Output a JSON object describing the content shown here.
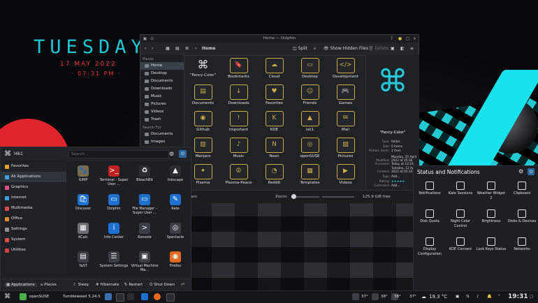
{
  "desktop": {
    "day": "TUESDAY",
    "date": "17 MAY 2022",
    "time": "· 07:31 PM ·",
    "accent": "#1fc7d6",
    "date_color": "#e23a3a"
  },
  "dolphin": {
    "title": "Home — Dolphin",
    "toolbar": {
      "location": "Home",
      "split": "Split",
      "show_hidden": "Show Hidden Files",
      "delete": "Delete"
    },
    "places_header": "Places",
    "places": [
      "Home",
      "Desktop",
      "Documents",
      "Downloads",
      "Music",
      "Pictures",
      "Videos",
      "Trash"
    ],
    "search_header": "Search For",
    "search_items": [
      "Documents",
      "Images"
    ],
    "files": [
      {
        "name": "\"Fancy-Color\"",
        "icon": "plasma-command-icon"
      },
      {
        "name": "Bookmarks",
        "icon": "bookmark-icon"
      },
      {
        "name": "Cloud",
        "icon": "cloud-icon"
      },
      {
        "name": "Desktop",
        "icon": "desktop-icon"
      },
      {
        "name": "Development",
        "icon": "code-icon"
      },
      {
        "name": "Documents",
        "icon": "document-icon"
      },
      {
        "name": "Downloads",
        "icon": "download-icon"
      },
      {
        "name": "Favorites",
        "icon": "heart-icon"
      },
      {
        "name": "Friends",
        "icon": "people-icon"
      },
      {
        "name": "Games",
        "icon": "gamepad-icon"
      },
      {
        "name": "Github",
        "icon": "github-icon"
      },
      {
        "name": "Important",
        "icon": "warning-icon"
      },
      {
        "name": "KDE",
        "icon": "kde-icon"
      },
      {
        "name": "lsk1",
        "icon": "android-icon"
      },
      {
        "name": "Mail",
        "icon": "mail-icon"
      },
      {
        "name": "Manjaro",
        "icon": "manjaro-icon"
      },
      {
        "name": "Music",
        "icon": "music-icon"
      },
      {
        "name": "Neon",
        "icon": "neon-icon"
      },
      {
        "name": "openSUSE",
        "icon": "opensuse-icon"
      },
      {
        "name": "Pictures",
        "icon": "picture-icon"
      },
      {
        "name": "Plasma",
        "icon": "plasma-icon"
      },
      {
        "name": "Plasma-Peace",
        "icon": "peace-icon"
      },
      {
        "name": "Reddit",
        "icon": "reddit-icon"
      },
      {
        "name": "Templates",
        "icon": "template-icon"
      },
      {
        "name": "Videos",
        "icon": "video-icon"
      }
    ],
    "info": {
      "name": "\"Fancy-Color\"",
      "rows": [
        {
          "k": "Type:",
          "v": "folder"
        },
        {
          "k": "Size:",
          "v": "0 items"
        },
        {
          "k": "Hidden items:",
          "v": "1 item"
        },
        {
          "k": "Modified:",
          "v": "Monday, 25 April 2022 at 05:30"
        },
        {
          "k": "Accessed:",
          "v": "Today at 12:16"
        },
        {
          "k": "Created:",
          "v": "Tuesday, 12 April 2022 at 05:30"
        },
        {
          "k": "Tags:",
          "v": "Add..."
        },
        {
          "k": "Rating:",
          "v": "★★★★★"
        },
        {
          "k": "Comment:",
          "v": "Add..."
        }
      ]
    },
    "status": {
      "folders": "olders",
      "zoom_label": "Zoom:",
      "free": "125.9 GiB free"
    }
  },
  "launcher": {
    "user": "l4k1",
    "search_placeholder": "Search...",
    "categories": [
      {
        "label": "Favorites",
        "color": "#e0a030"
      },
      {
        "label": "All Applications",
        "color": "#3da0e0"
      },
      {
        "label": "Graphics",
        "color": "#e04a8a"
      },
      {
        "label": "Internet",
        "color": "#3da0e0"
      },
      {
        "label": "Multimedia",
        "color": "#e04a4a"
      },
      {
        "label": "Office",
        "color": "#e08a30"
      },
      {
        "label": "Settings",
        "color": "#8a9096"
      },
      {
        "label": "System",
        "color": "#e04a4a"
      },
      {
        "label": "Utilities",
        "color": "#d04040"
      }
    ],
    "apps": [
      {
        "label": "GIMP",
        "icon": "gimp-icon",
        "color": "#7a6a50",
        "glyph": "🐾"
      },
      {
        "label": "Terminal - Super User ...",
        "icon": "terminal-icon",
        "color": "#c02020",
        "glyph": ">_"
      },
      {
        "label": "BleachBit",
        "icon": "bleachbit-icon",
        "color": "#2a2e33",
        "glyph": "♻"
      },
      {
        "label": "Inkscape",
        "icon": "inkscape-icon",
        "color": "#2a2e33",
        "glyph": "▲"
      },
      {
        "label": "Discover",
        "icon": "discover-icon",
        "color": "#1d6fd0",
        "glyph": "🛍"
      },
      {
        "label": "Dolphin",
        "icon": "dolphin-icon",
        "color": "#1d6fd0",
        "glyph": "▭"
      },
      {
        "label": "File Manager - Super User ...",
        "icon": "file-manager-icon",
        "color": "#1d6fd0",
        "glyph": "▭"
      },
      {
        "label": "Kate",
        "icon": "kate-icon",
        "color": "#1d6fd0",
        "glyph": "✎"
      },
      {
        "label": "KCalc",
        "icon": "kcalc-icon",
        "color": "#6a6f76",
        "glyph": "▦"
      },
      {
        "label": "Info Center",
        "icon": "info-icon",
        "color": "#1d6fd0",
        "glyph": "i"
      },
      {
        "label": "Konsole",
        "icon": "konsole-icon",
        "color": "#3a3f45",
        "glyph": ">"
      },
      {
        "label": "Spectacle",
        "icon": "spectacle-icon",
        "color": "#3a3f45",
        "glyph": "◎"
      },
      {
        "label": "YaST",
        "icon": "yast-icon",
        "color": "#3a3f45",
        "glyph": "▤"
      },
      {
        "label": "System Settings",
        "icon": "system-settings-icon",
        "color": "#3a3f45",
        "glyph": "☰"
      },
      {
        "label": "Virtual Machine Ma...",
        "icon": "virt-manager-icon",
        "color": "#3a3f45",
        "glyph": "▣"
      },
      {
        "label": "Firefox",
        "icon": "firefox-icon",
        "color": "#e06a20",
        "glyph": "◉"
      }
    ],
    "footer": {
      "applications": "Applications",
      "places": "Places",
      "sleep": "Sleep",
      "hibernate": "Hibernate",
      "restart": "Restart",
      "shutdown": "Shut Down"
    }
  },
  "notifications": {
    "title": "Status and Notifications",
    "tiles": [
      {
        "label": "Notifications",
        "icon": "bell-icon"
      },
      {
        "label": "Kate Sessions",
        "icon": "kate-sessions-icon"
      },
      {
        "label": "Weather Widget 2",
        "icon": "weather-icon"
      },
      {
        "label": "Clipboard",
        "icon": "clipboard-icon"
      },
      {
        "label": "Disk Quota",
        "icon": "disk-quota-icon"
      },
      {
        "label": "Night Color Control",
        "icon": "night-color-icon"
      },
      {
        "label": "Brightness",
        "icon": "brightness-icon"
      },
      {
        "label": "Disks & Devices",
        "icon": "disks-icon"
      },
      {
        "label": "Display Configuration",
        "icon": "display-icon"
      },
      {
        "label": "KDE Connect",
        "icon": "kde-connect-icon"
      },
      {
        "label": "Lock Keys Status",
        "icon": "lock-keys-icon"
      },
      {
        "label": "Networks",
        "icon": "network-icon"
      }
    ]
  },
  "taskbar": {
    "distro": "openSUSE",
    "version": "Tumbleweed 5.24.5",
    "temps": [
      "37°",
      "38°",
      "38°",
      "37°"
    ],
    "weather": "19.3 °C",
    "clock": "19:31"
  }
}
